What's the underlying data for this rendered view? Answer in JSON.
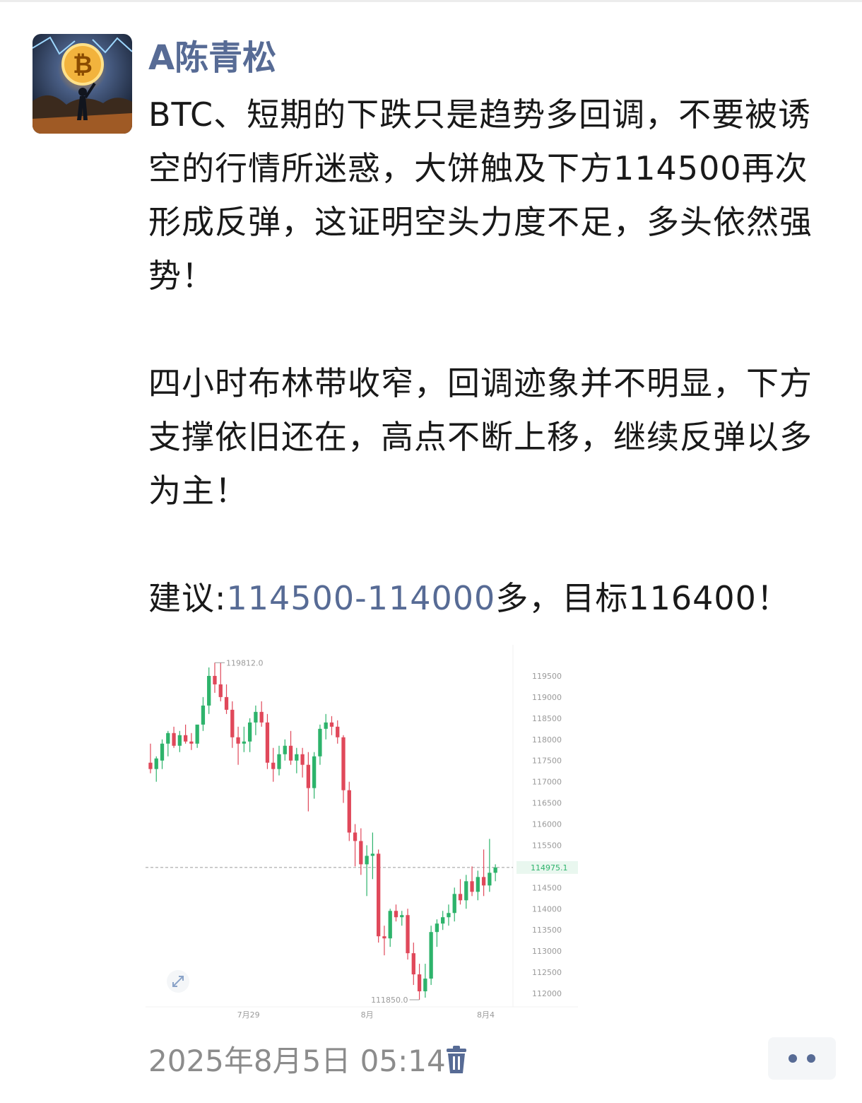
{
  "post": {
    "author": "A陈青松",
    "paragraphs": [
      "BTC、短期的下跌只是趋势多回调，不要被诱空的行情所迷惑，大饼触及下方114500再次形成反弹，这证明空头力度不足，多头依然强势！",
      "四小时布林带收窄，回调迹象并不明显，下方支撑依旧还在，高点不断上移，继续反弹以多为主！"
    ],
    "suggestion": {
      "prefix": "建议:",
      "range_link": "114500-114000",
      "suffix": "多，目标116400！"
    },
    "timestamp": "2025年8月5日 05:14"
  },
  "icons": {
    "avatar": "bitcoin-storm-avatar",
    "trash": "trash-icon",
    "more": "more-dots-icon",
    "expand": "expand-icon"
  },
  "colors": {
    "link": "#576b95",
    "up": "#2db36b",
    "down": "#e0485a",
    "meta": "#8c8c8c"
  },
  "chart_data": {
    "type": "candlestick",
    "x_tick_labels": [
      "7月29",
      "8月",
      "8月4"
    ],
    "y_ticks": [
      119500,
      119000,
      118500,
      118000,
      117500,
      117000,
      116500,
      116000,
      115500,
      114500,
      114000,
      113500,
      113000,
      112500,
      112000
    ],
    "ylim": [
      111800,
      119900
    ],
    "high_label": "119812.0",
    "low_label": "111850.0",
    "last_price_label": "114975.1",
    "last_price": 114975.1,
    "candles": [
      {
        "o": 117450,
        "h": 117900,
        "l": 117200,
        "c": 117300
      },
      {
        "o": 117300,
        "h": 117600,
        "l": 117000,
        "c": 117550
      },
      {
        "o": 117500,
        "h": 118000,
        "l": 117300,
        "c": 117900
      },
      {
        "o": 117900,
        "h": 118200,
        "l": 117600,
        "c": 118150
      },
      {
        "o": 118150,
        "h": 118300,
        "l": 117800,
        "c": 117850
      },
      {
        "o": 117850,
        "h": 118200,
        "l": 117700,
        "c": 118100
      },
      {
        "o": 118100,
        "h": 118350,
        "l": 117900,
        "c": 117950
      },
      {
        "o": 117950,
        "h": 118150,
        "l": 117750,
        "c": 117900
      },
      {
        "o": 117900,
        "h": 118300,
        "l": 117800,
        "c": 118350
      },
      {
        "o": 118350,
        "h": 119000,
        "l": 118200,
        "c": 118800
      },
      {
        "o": 118800,
        "h": 119700,
        "l": 118600,
        "c": 119500
      },
      {
        "o": 119500,
        "h": 119812,
        "l": 119100,
        "c": 119300
      },
      {
        "o": 119300,
        "h": 119812,
        "l": 118900,
        "c": 119000
      },
      {
        "o": 119000,
        "h": 119300,
        "l": 118600,
        "c": 118700
      },
      {
        "o": 118700,
        "h": 118900,
        "l": 117800,
        "c": 118050
      },
      {
        "o": 118050,
        "h": 118300,
        "l": 117400,
        "c": 117900
      },
      {
        "o": 117900,
        "h": 118300,
        "l": 117700,
        "c": 117950
      },
      {
        "o": 117950,
        "h": 118500,
        "l": 117700,
        "c": 118400
      },
      {
        "o": 118400,
        "h": 118800,
        "l": 118100,
        "c": 118650
      },
      {
        "o": 118650,
        "h": 118900,
        "l": 118300,
        "c": 118400
      },
      {
        "o": 118400,
        "h": 118600,
        "l": 117300,
        "c": 117450
      },
      {
        "o": 117450,
        "h": 117800,
        "l": 117000,
        "c": 117300
      },
      {
        "o": 117300,
        "h": 117850,
        "l": 117150,
        "c": 117650
      },
      {
        "o": 117650,
        "h": 118000,
        "l": 117500,
        "c": 117850
      },
      {
        "o": 117850,
        "h": 118200,
        "l": 117400,
        "c": 117500
      },
      {
        "o": 117500,
        "h": 117800,
        "l": 117200,
        "c": 117650
      },
      {
        "o": 117650,
        "h": 117800,
        "l": 117100,
        "c": 117400
      },
      {
        "o": 117400,
        "h": 117700,
        "l": 116300,
        "c": 116850
      },
      {
        "o": 116850,
        "h": 117700,
        "l": 116600,
        "c": 117600
      },
      {
        "o": 117600,
        "h": 118350,
        "l": 117400,
        "c": 118250
      },
      {
        "o": 118250,
        "h": 118600,
        "l": 118000,
        "c": 118400
      },
      {
        "o": 118400,
        "h": 118550,
        "l": 118100,
        "c": 118300
      },
      {
        "o": 118300,
        "h": 118450,
        "l": 117900,
        "c": 118050
      },
      {
        "o": 118050,
        "h": 118100,
        "l": 116500,
        "c": 116800
      },
      {
        "o": 116800,
        "h": 117000,
        "l": 115600,
        "c": 115800
      },
      {
        "o": 115800,
        "h": 116000,
        "l": 115000,
        "c": 115600
      },
      {
        "o": 115600,
        "h": 115900,
        "l": 114800,
        "c": 115050
      },
      {
        "o": 115050,
        "h": 115500,
        "l": 114300,
        "c": 115250
      },
      {
        "o": 115250,
        "h": 115800,
        "l": 114700,
        "c": 115300
      },
      {
        "o": 115300,
        "h": 115400,
        "l": 113200,
        "c": 113350
      },
      {
        "o": 113350,
        "h": 113600,
        "l": 112900,
        "c": 113300
      },
      {
        "o": 113300,
        "h": 114000,
        "l": 113100,
        "c": 113950
      },
      {
        "o": 113950,
        "h": 114100,
        "l": 113700,
        "c": 113800
      },
      {
        "o": 113800,
        "h": 113950,
        "l": 113600,
        "c": 113850
      },
      {
        "o": 113850,
        "h": 114000,
        "l": 112800,
        "c": 112950
      },
      {
        "o": 112950,
        "h": 113200,
        "l": 112200,
        "c": 112450
      },
      {
        "o": 112450,
        "h": 112700,
        "l": 111850,
        "c": 112050
      },
      {
        "o": 112050,
        "h": 112700,
        "l": 111900,
        "c": 112350
      },
      {
        "o": 112350,
        "h": 113600,
        "l": 112200,
        "c": 113450
      },
      {
        "o": 113450,
        "h": 113750,
        "l": 113100,
        "c": 113650
      },
      {
        "o": 113650,
        "h": 113950,
        "l": 113500,
        "c": 113800
      },
      {
        "o": 113800,
        "h": 114100,
        "l": 113600,
        "c": 113900
      },
      {
        "o": 113900,
        "h": 114500,
        "l": 113700,
        "c": 114350
      },
      {
        "o": 114350,
        "h": 114700,
        "l": 114100,
        "c": 114200
      },
      {
        "o": 114200,
        "h": 114800,
        "l": 114000,
        "c": 114650
      },
      {
        "o": 114650,
        "h": 115000,
        "l": 114300,
        "c": 114400
      },
      {
        "o": 114400,
        "h": 114900,
        "l": 114200,
        "c": 114750
      },
      {
        "o": 114750,
        "h": 115400,
        "l": 114300,
        "c": 114550
      },
      {
        "o": 114550,
        "h": 115650,
        "l": 114400,
        "c": 114850
      },
      {
        "o": 114850,
        "h": 115050,
        "l": 114650,
        "c": 114975
      }
    ]
  }
}
